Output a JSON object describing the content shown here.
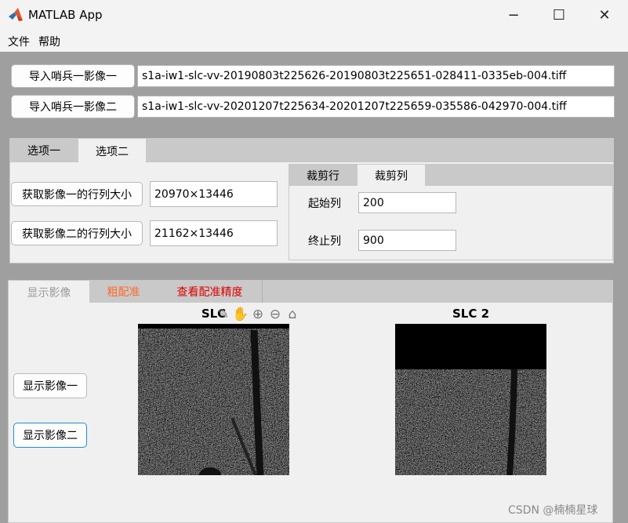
{
  "window": {
    "title": "MATLAB App",
    "icon": "matlab-icon",
    "controls": [
      "−",
      "☐",
      "✕"
    ]
  },
  "menu": [
    "文件",
    "帮助"
  ],
  "imports": [
    {
      "button": "导入哨兵一影像一",
      "path": "s1a-iw1-slc-vv-20190803t225626-20190803t225651-028411-0335eb-004.tiff"
    },
    {
      "button": "导入哨兵一影像二",
      "path": "s1a-iw1-slc-vv-20201207t225634-20201207t225659-035586-042970-004.tiff"
    }
  ],
  "options_panel": {
    "tabs": [
      "选项一",
      "选项二"
    ],
    "active_tab": "选项二",
    "size1_button": "获取影像一的行列大小",
    "size1_value": "20970×13446",
    "size2_button": "获取影像二的行列大小",
    "size2_value": "21162×13446",
    "crop": {
      "tabs": [
        "裁剪行",
        "裁剪列"
      ],
      "active_tab": "裁剪列",
      "start_label": "起始列",
      "start_value": "200",
      "end_label": "终止列",
      "end_value": "900"
    }
  },
  "display_panel": {
    "tabs": [
      {
        "label": "显示影像",
        "color": "#9a9a9a"
      },
      {
        "label": "粗配准",
        "color": "#ff6a2a"
      },
      {
        "label": "查看配准精度",
        "color": "#e00000"
      }
    ],
    "show1_button": "显示影像一",
    "show2_button": "显示影像二",
    "axes1_title": "SLC",
    "axes2_title": "SLC 2",
    "toolbar_icons": [
      "brush-icon",
      "pan-icon",
      "zoom-in-icon",
      "zoom-out-icon",
      "home-icon"
    ],
    "toolbar_glyphs": [
      "✎",
      "✋",
      "⊕",
      "⊖",
      "⌂"
    ]
  },
  "watermark": "CSDN @楠楠星球",
  "accent_color": "#1e8fd6"
}
